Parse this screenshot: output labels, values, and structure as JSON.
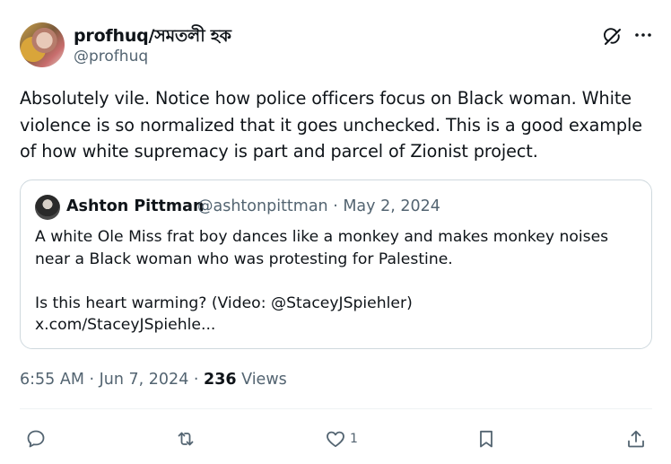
{
  "author": {
    "name": "profhuq/সমতলী হক",
    "handle": "@profhuq"
  },
  "tweet": {
    "text": "Absolutely vile. Notice how police officers focus on Black woman. White violence is so normalized that it goes unchecked. This is a good example of how white supremacy is part and parcel of Zionist project."
  },
  "quote": {
    "name": "Ashton Pittman",
    "handle_date": "@ashtonpittman · May 2, 2024",
    "paragraph1": "A white Ole Miss frat boy dances like a monkey and makes monkey noises near a Black woman who was protesting for Palestine.",
    "paragraph2": "Is this heart warming? (Video: @StaceyJSpiehler)",
    "link": "x.com/StaceyJSpiehle..."
  },
  "meta": {
    "timestamp": "6:55 AM · Jun 7, 2024 · ",
    "views_count": "236",
    "views_label": " Views"
  },
  "actions": {
    "reply_icon": "reply-icon",
    "repost_icon": "repost-icon",
    "like_icon": "heart-icon",
    "like_count": "1",
    "bookmark_icon": "bookmark-icon",
    "share_icon": "share-icon"
  },
  "colors": {
    "text": "#0f1419",
    "secondary": "#536471",
    "border": "#cfd9de"
  }
}
